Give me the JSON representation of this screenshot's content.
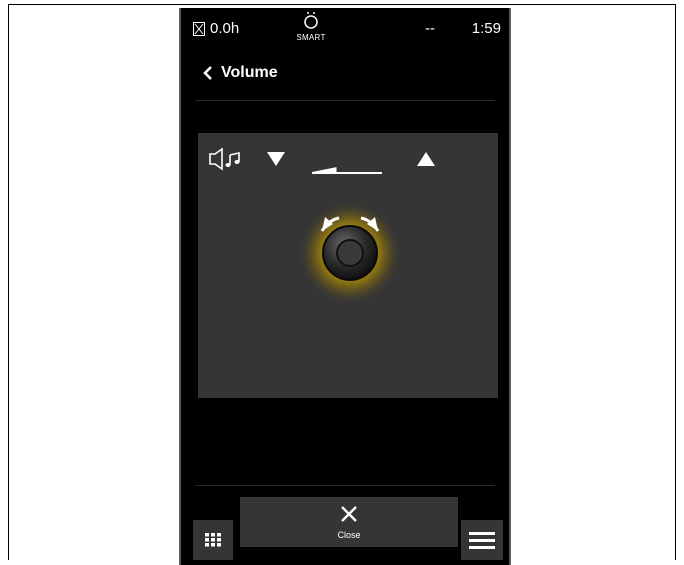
{
  "status": {
    "timer": "0.0h",
    "mode_label": "SMART",
    "signal": "--",
    "time": "1:59"
  },
  "header": {
    "title": "Volume"
  },
  "volume": {
    "level": 0.35
  },
  "footer": {
    "close_label": "Close"
  },
  "colors": {
    "background": "#000000",
    "panel": "#353535",
    "glow": "#c8a000",
    "text": "#ffffff"
  },
  "icons": [
    "hourglass-icon",
    "smart-bulb-icon",
    "back-chevron-icon",
    "speaker-music-icon",
    "volume-down-icon",
    "volume-level-icon",
    "volume-up-icon",
    "rotary-knob-icon",
    "close-icon",
    "grid-icon",
    "menu-icon"
  ]
}
